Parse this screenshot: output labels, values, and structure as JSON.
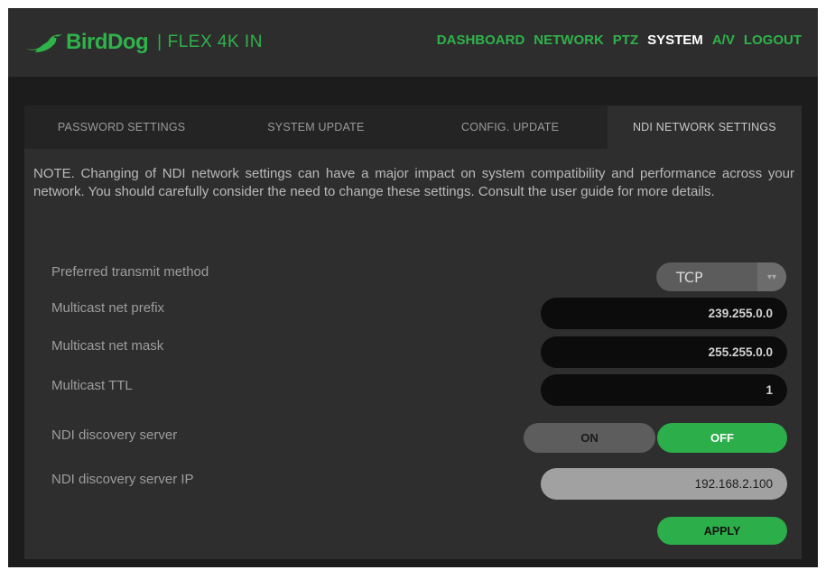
{
  "header": {
    "brand": "BirdDog",
    "separator": "|",
    "model": "FLEX 4K IN",
    "logo_icon": "bird-icon",
    "accent_color": "#2fb24a"
  },
  "nav": {
    "items": [
      "DASHBOARD",
      "NETWORK",
      "PTZ",
      "SYSTEM",
      "A/V",
      "LOGOUT"
    ],
    "active": "SYSTEM"
  },
  "tabs": {
    "items": [
      "PASSWORD SETTINGS",
      "SYSTEM UPDATE",
      "CONFIG. UPDATE",
      "NDI NETWORK SETTINGS"
    ],
    "active": "NDI NETWORK SETTINGS"
  },
  "note": "NOTE. Changing of NDI network settings can have a major impact on system compatibility and performance across your network. You should carefully consider the need to change these settings. Consult the user guide for more details.",
  "settings": {
    "transmit_method": {
      "label": "Preferred transmit method",
      "value": "TCP",
      "arrow_glyph": "▾▾"
    },
    "multicast_prefix": {
      "label": "Multicast net prefix",
      "value": "239.255.0.0"
    },
    "multicast_mask": {
      "label": "Multicast net mask",
      "value": "255.255.0.0"
    },
    "multicast_ttl": {
      "label": "Multicast TTL",
      "value": "1"
    },
    "discovery_server": {
      "label": "NDI discovery server",
      "on_label": "ON",
      "off_label": "OFF",
      "selected": "OFF"
    },
    "discovery_server_ip": {
      "label": "NDI discovery server IP",
      "value": "192.168.2.100"
    }
  },
  "actions": {
    "apply_label": "APPLY"
  }
}
